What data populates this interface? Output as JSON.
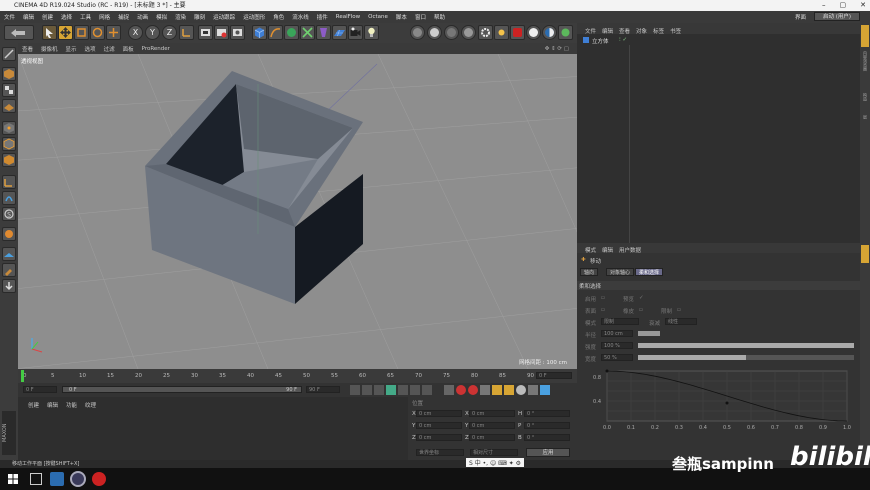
{
  "title_bar": {
    "title": "CINEMA 4D R19.024 Studio (RC - R19) - [未标题 3 *] - 主要",
    "minimize": "–",
    "maximize": "▢",
    "close": "✕"
  },
  "menu": {
    "items": [
      "文件",
      "编辑",
      "创建",
      "选择",
      "工具",
      "网格",
      "捕捉",
      "动画",
      "模拟",
      "渲染",
      "雕刻",
      "运动跟踪",
      "运动图形",
      "角色",
      "流水线",
      "插件",
      "RealFlow",
      "Octane",
      "脚本",
      "窗口",
      "帮助"
    ],
    "layout_label": "界面",
    "layout_value": "启动 (用户)"
  },
  "toolbar": {
    "axis_x": "X",
    "axis_y": "Y",
    "axis_z": "Z"
  },
  "viewport": {
    "menu": [
      "查看",
      "摄像机",
      "显示",
      "选项",
      "过滤",
      "面板",
      "ProRender"
    ],
    "name": "透视视图",
    "grid_info": "网格间距 : 100 cm"
  },
  "timeline": {
    "ticks": [
      "0",
      "5",
      "10",
      "15",
      "20",
      "25",
      "30",
      "35",
      "40",
      "45",
      "50",
      "55",
      "60",
      "65",
      "70",
      "75",
      "80",
      "85",
      "90"
    ],
    "frame_right": "0 F"
  },
  "playback": {
    "start": "0 F",
    "cur": "0 F",
    "end": "90 F",
    "end2": "90 F"
  },
  "materials": {
    "menu": [
      "创建",
      "编辑",
      "功能",
      "纹理"
    ]
  },
  "coords": {
    "header": "位置",
    "rows": [
      {
        "a": "X",
        "av": "0 cm",
        "b": "X",
        "bv": "0 cm",
        "c": "H",
        "cv": "0 °"
      },
      {
        "a": "Y",
        "av": "0 cm",
        "b": "Y",
        "bv": "0 cm",
        "c": "P",
        "cv": "0 °"
      },
      {
        "a": "Z",
        "av": "0 cm",
        "b": "Z",
        "bv": "0 cm",
        "c": "B",
        "cv": "0 °"
      }
    ],
    "mode1": "世界坐标",
    "mode2": "相对尺寸",
    "apply": "应用"
  },
  "object_manager": {
    "menu": [
      "文件",
      "编辑",
      "查看",
      "对象",
      "标签",
      "书签"
    ],
    "object_name": "立方体"
  },
  "attribute_manager": {
    "menu": [
      "模式",
      "编辑",
      "用户数据"
    ],
    "tool_name": "移动",
    "tabs": [
      "轴向",
      "对象轴心",
      "柔和选择"
    ],
    "section": "柔和选择",
    "enable_label": "启用",
    "preview_label": "预览",
    "surface_label": "表面",
    "rubber_label": "橡皮",
    "restrict_label": "限制",
    "mode_label": "模式",
    "mode_value": "限制",
    "falloff_label": "衰减",
    "falloff_value": "线性",
    "radius_label": "半径",
    "radius_value": "100 cm",
    "strength_label": "强度",
    "strength_value": "100 %",
    "width_label": "宽度",
    "width_value": "50 %",
    "strength_fill": 1.0,
    "width_fill": 0.5
  },
  "graph": {
    "y_labels": [
      "0.8",
      "0.4"
    ],
    "x_labels": [
      "0.0",
      "0.1",
      "0.2",
      "0.3",
      "0.4",
      "0.5",
      "0.6",
      "0.7",
      "0.8",
      "0.9",
      "1.0"
    ]
  },
  "status": "移动工作平面 [按键SHIFT+X]",
  "watermark": {
    "user": "叁瓶sampinn",
    "brand": "bilibili"
  },
  "right_strip": [
    "对象",
    "内容浏览器",
    "构造",
    "层"
  ]
}
